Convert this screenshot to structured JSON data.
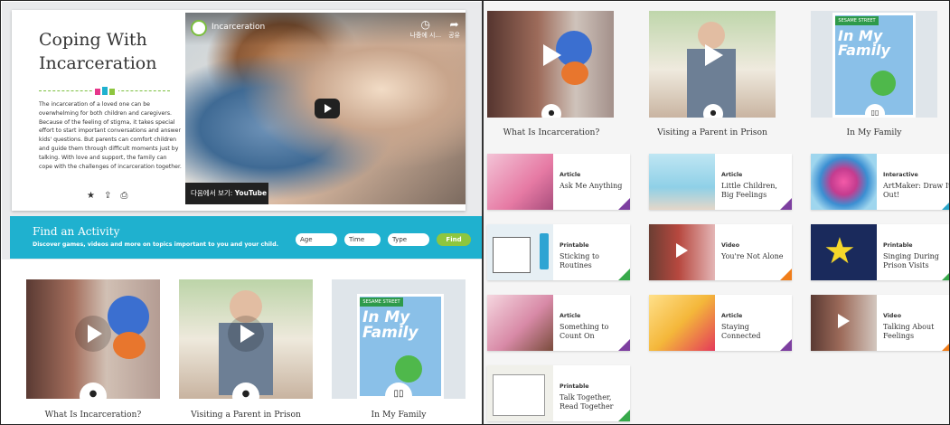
{
  "hero": {
    "title": "Coping With Incarceration",
    "description": "The incarceration of a loved one can be overwhelming for both children and caregivers. Because of the feeling of stigma, it takes special effort to start important conversations and answer kids' questions. But parents can comfort children and guide them through difficult moments just by talking. With love and support, the family can cope with the challenges of incarceration together.",
    "actions": {
      "favorite_icon": "star-icon",
      "share_icon": "share-icon",
      "print_icon": "print-icon"
    },
    "video": {
      "title": "Incarceration",
      "watch_later_label": "나중에 시...",
      "share_label": "공유",
      "watch_on": "다음에서 보기:",
      "youtube": "YouTube"
    }
  },
  "activity": {
    "title": "Find an Activity",
    "subtitle": "Discover games, videos and more on topics important to you and your child.",
    "filters": [
      "Age",
      "Time",
      "Type"
    ],
    "find_label": "Find"
  },
  "bottom_cards": [
    {
      "caption": "What Is Incarceration?",
      "icon": "play-icon"
    },
    {
      "caption": "Visiting a Parent in Prison",
      "icon": "play-icon"
    },
    {
      "caption": "In My Family",
      "icon": "book-icon"
    }
  ],
  "right": {
    "top_cards": [
      {
        "caption": "What Is Incarceration?",
        "icon": "play-icon"
      },
      {
        "caption": "Visiting a Parent in Prison",
        "icon": "play-icon"
      },
      {
        "caption": "In My Family",
        "icon": "book-icon"
      }
    ],
    "book_brand": "SESAME STREET",
    "book_title": "In My Family",
    "resources": [
      {
        "kind": "Article",
        "title": "Ask Me Anything",
        "color": "#7d3fa0"
      },
      {
        "kind": "Article",
        "title": "Little Children, Big Feelings",
        "color": "#7d3fa0"
      },
      {
        "kind": "Interactive",
        "title": "ArtMaker: Draw It Out!",
        "color": "#2aa6c9"
      },
      {
        "kind": "Printable",
        "title": "Sticking to Routines",
        "color": "#37a94b"
      },
      {
        "kind": "Video",
        "title": "You're Not Alone",
        "color": "#f07d1a"
      },
      {
        "kind": "Printable",
        "title": "Singing During Prison Visits",
        "color": "#37a94b"
      },
      {
        "kind": "Article",
        "title": "Something to Count On",
        "color": "#7d3fa0"
      },
      {
        "kind": "Article",
        "title": "Staying Connected",
        "color": "#7d3fa0"
      },
      {
        "kind": "Video",
        "title": "Talking About Feelings",
        "color": "#f07d1a"
      },
      {
        "kind": "Printable",
        "title": "Talk Together, Read Together",
        "color": "#37a94b"
      }
    ]
  }
}
